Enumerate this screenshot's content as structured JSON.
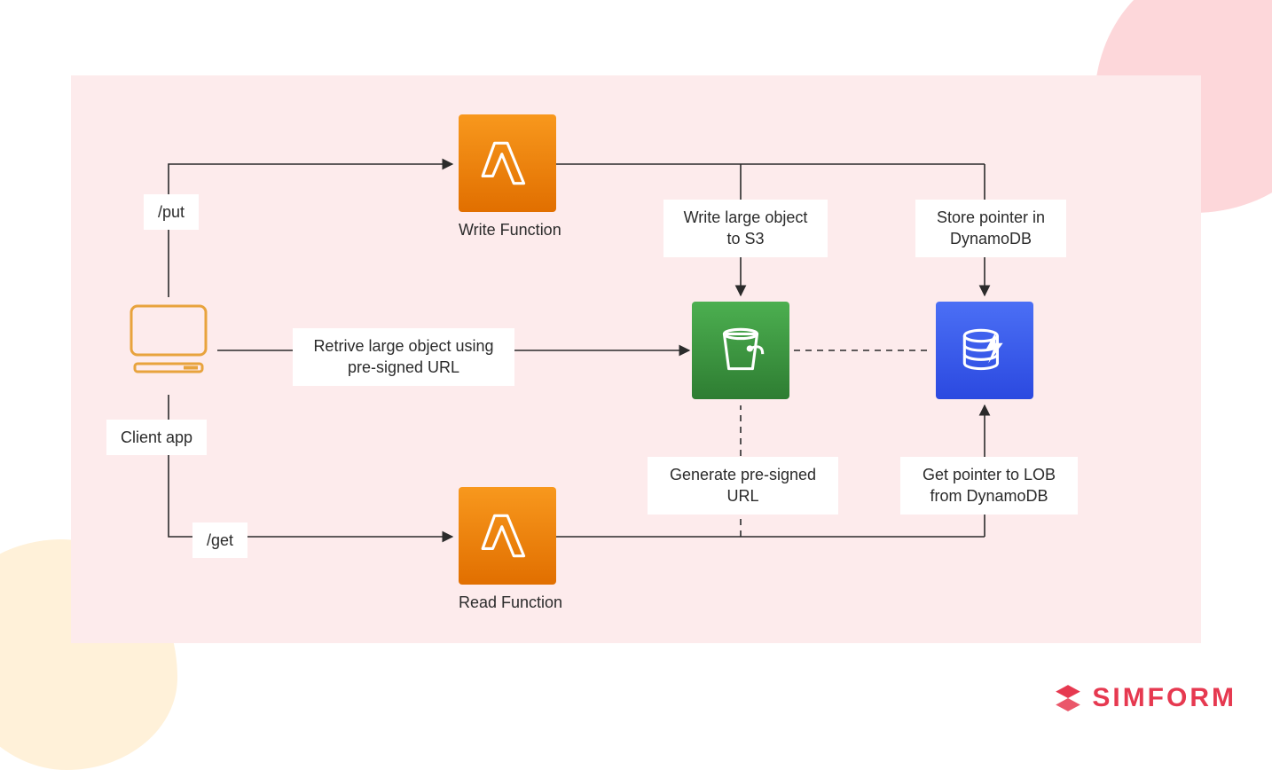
{
  "nodes": {
    "client": {
      "label": "Client app"
    },
    "write_fn": {
      "label": "Write Function",
      "icon": "lambda"
    },
    "read_fn": {
      "label": "Read Function",
      "icon": "lambda"
    },
    "s3": {
      "icon": "s3"
    },
    "dynamo": {
      "icon": "dynamodb"
    }
  },
  "edges": {
    "put": "/put",
    "get": "/get",
    "retrieve": "Retrive large object using\npre-signed URL",
    "write_s3": "Write large object\nto S3",
    "store_ptr": "Store pointer in\nDynamoDB",
    "gen_url": "Generate pre-signed\nURL",
    "get_ptr": "Get pointer to LOB\nfrom DynamoDB"
  },
  "brand": "SIMFORM",
  "colors": {
    "panel": "#fdebec",
    "lambda": "#f58a1f",
    "s3": "#3e8e41",
    "dynamo": "#3d5af1",
    "accent": "#e63950",
    "client_stroke": "#e8a33d"
  }
}
